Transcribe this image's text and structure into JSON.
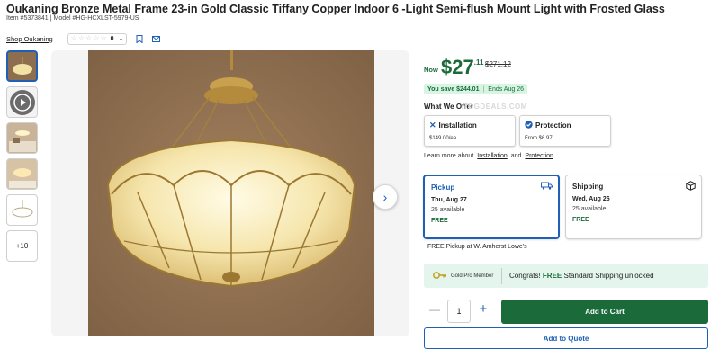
{
  "product": {
    "title": "Oukaning Bronze Metal Frame 23-in Gold Classic Tiffany Copper Indoor 6 -Light Semi-flush Mount Light with Frosted Glass",
    "item_label": "Item #5373841",
    "model_label": "Model #HG-HCXLST-5979-US",
    "shop_link": "Shop Oukaning",
    "rating_count": "0",
    "stars": [
      "☆",
      "☆",
      "☆",
      "☆",
      "☆"
    ]
  },
  "gallery": {
    "more_label": "+10",
    "next_icon": "chevron-right-icon"
  },
  "price": {
    "now_label": "Now",
    "dollars": "$27",
    "cents": ".11",
    "was": "$271.12",
    "save_text": "You save $244.01",
    "ends_text": "Ends Aug 26"
  },
  "offers": {
    "heading": "What We Offer",
    "watermark": "TDGDEALS.COM",
    "installation": {
      "title": "Installation",
      "sub": "$149.00/ea"
    },
    "protection": {
      "title": "Protection",
      "sub": "From $6.97"
    },
    "learn_prefix": "Learn more about",
    "learn_install": "Installation",
    "learn_and": "and",
    "learn_protect": "Protection",
    "learn_suffix": "."
  },
  "fulfillment": {
    "pickup": {
      "title": "Pickup",
      "date": "Thu, Aug 27",
      "avail": "25 available",
      "price": "FREE"
    },
    "shipping": {
      "title": "Shipping",
      "date": "Wed, Aug 26",
      "avail": "25 available",
      "price": "FREE"
    },
    "pickup_note": "FREE Pickup at W. Amherst Lowe's"
  },
  "pro": {
    "label": "Gold Pro Member",
    "msg_prefix": "Congrats!",
    "msg_free": "FREE",
    "msg_suffix": "Standard Shipping unlocked"
  },
  "cart": {
    "quantity": "1",
    "minus": "—",
    "plus": "+",
    "add_to_cart": "Add to Cart",
    "add_to_quote": "Add to Quote"
  },
  "colors": {
    "brand_green": "#1b6b3a",
    "brand_blue": "#1f5fb6",
    "badge_bg": "#d8f4e3",
    "pro_bg": "#e3f5ec"
  }
}
